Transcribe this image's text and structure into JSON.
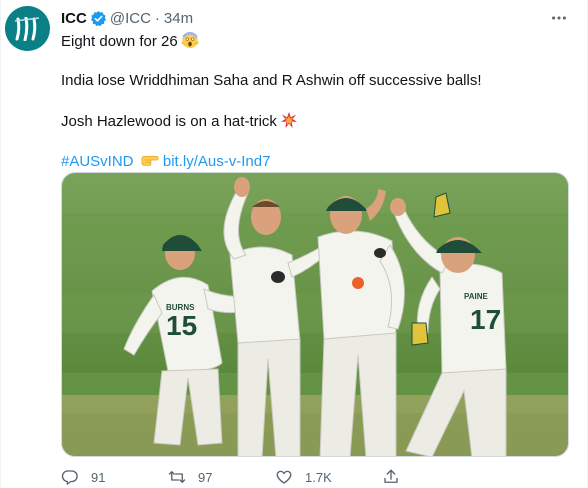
{
  "tweet": {
    "author": {
      "display_name": "ICC",
      "handle": "@ICC",
      "verified": true,
      "avatar_icon": "icc-logo"
    },
    "separator": "·",
    "timestamp": "34m",
    "lines": [
      "Eight down for 26",
      "India lose Wriddhiman Saha and R Ashwin off successive balls!",
      "Josh Hazlewood is on a hat-trick"
    ],
    "hashtag": "#AUSvIND",
    "link": "bit.ly/Aus-v-Ind7",
    "emojis": [
      "face-screaming-in-fear",
      "collision",
      "backhand-index-pointing-right"
    ],
    "media": {
      "jersey_numbers": [
        "15",
        "17"
      ],
      "jersey_names": [
        "BURNS",
        "PAINE"
      ]
    },
    "actions": {
      "reply_count": "91",
      "retweet_count": "97",
      "like_count": "1.7K",
      "share_label": ""
    },
    "colors": {
      "accent": "#1d9bf0",
      "text": "#0f1419",
      "muted": "#536471",
      "grass": "#5f8f3e",
      "shirt": "#f4f4ef",
      "cap": "#1f4d3a"
    }
  }
}
